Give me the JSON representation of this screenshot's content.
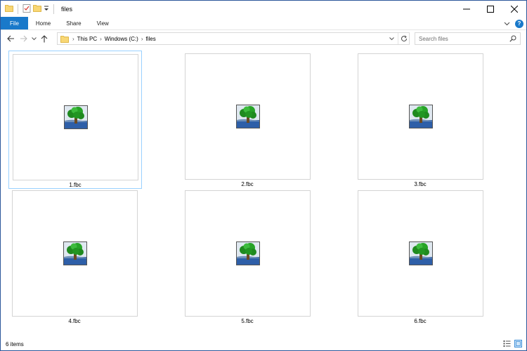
{
  "window": {
    "title": "files"
  },
  "ribbon": {
    "tabs": [
      "File",
      "Home",
      "Share",
      "View"
    ]
  },
  "address": {
    "crumbs": [
      "This PC",
      "Windows (C:)",
      "files"
    ]
  },
  "search": {
    "placeholder": "Search files"
  },
  "files": [
    {
      "name": "1.fbc",
      "icon": "tree-thumbnail-icon",
      "selected": true
    },
    {
      "name": "2.fbc",
      "icon": "tree-thumbnail-icon",
      "selected": false
    },
    {
      "name": "3.fbc",
      "icon": "tree-thumbnail-icon",
      "selected": false
    },
    {
      "name": "4.fbc",
      "icon": "tree-thumbnail-icon",
      "selected": false
    },
    {
      "name": "5.fbc",
      "icon": "tree-thumbnail-icon",
      "selected": false
    },
    {
      "name": "6.fbc",
      "icon": "tree-thumbnail-icon",
      "selected": false
    }
  ],
  "status": {
    "item_count": "6 items"
  },
  "colors": {
    "accent": "#1979ca",
    "selection_border": "#99d1ff",
    "thumb_border": "#d4d4d4",
    "window_border": "#2b579a"
  }
}
